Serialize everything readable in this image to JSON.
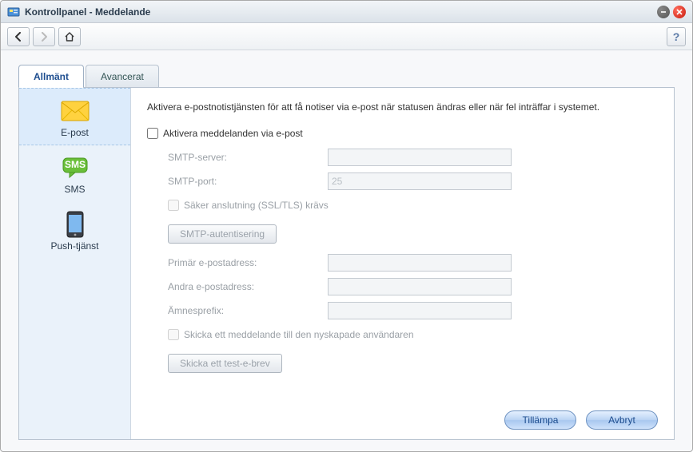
{
  "window": {
    "title": "Kontrollpanel - Meddelande"
  },
  "toolbar": {
    "help": "?"
  },
  "tabs": [
    {
      "label": "Allmänt",
      "active": true
    },
    {
      "label": "Avancerat",
      "active": false
    }
  ],
  "sidebar": {
    "items": [
      {
        "label": "E-post",
        "icon": "mail-icon",
        "selected": true
      },
      {
        "label": "SMS",
        "icon": "sms-icon",
        "selected": false
      },
      {
        "label": "Push-tjänst",
        "icon": "push-icon",
        "selected": false
      }
    ]
  },
  "main": {
    "intro": "Aktivera e-postnotistjänsten för att få notiser via e-post när statusen ändras eller när fel inträffar i systemet.",
    "enable_checkbox": "Aktivera meddelanden via e-post",
    "fields": {
      "smtp_server": {
        "label": "SMTP-server:",
        "value": ""
      },
      "smtp_port": {
        "label": "SMTP-port:",
        "placeholder": "25",
        "value": ""
      },
      "ssl": {
        "label": "Säker anslutning (SSL/TLS) krävs"
      },
      "auth_btn": "SMTP-autentisering",
      "primary": {
        "label": "Primär e-postadress:",
        "value": ""
      },
      "secondary": {
        "label": "Andra e-postadress:",
        "value": ""
      },
      "prefix": {
        "label": "Ämnesprefix:",
        "value": ""
      },
      "send_new": {
        "label": "Skicka ett meddelande till den nyskapade användaren"
      },
      "test_btn": "Skicka ett test-e-brev"
    }
  },
  "footer": {
    "apply": "Tillämpa",
    "cancel": "Avbryt"
  }
}
